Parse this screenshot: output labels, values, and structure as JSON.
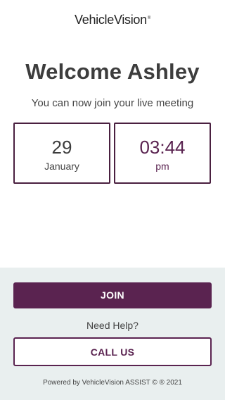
{
  "header": {
    "logo_text": "VehicleVision",
    "logo_mark": "®"
  },
  "main": {
    "title": "Welcome Ashley",
    "subtitle": "You can now join your live meeting",
    "date": {
      "day": "29",
      "month": "January"
    },
    "time": {
      "value": "03:44",
      "meridiem": "pm"
    }
  },
  "actions": {
    "join_label": "JOIN",
    "help_text": "Need Help?",
    "call_label": "CALL US"
  },
  "footer": {
    "text": "Powered by VehicleVision ASSIST © ® 2021"
  },
  "colors": {
    "brand": "#5a2350",
    "bottom_bg": "#e9efef",
    "text": "#3d3d3d"
  }
}
